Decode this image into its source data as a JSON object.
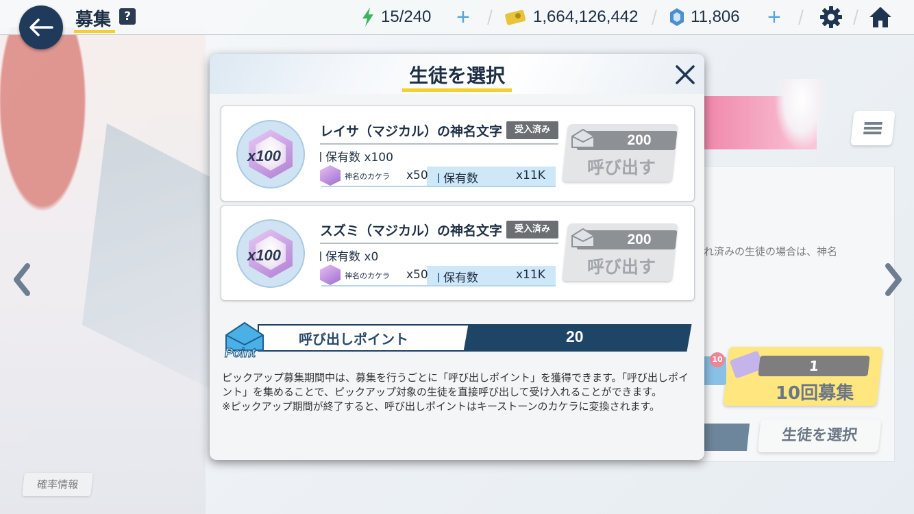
{
  "topbar": {
    "title": "募集",
    "help": "?",
    "ap": "15/240",
    "credits": "1,664,126,442",
    "gems": "11,806"
  },
  "background": {
    "panel_text": "入れ済みの生徒の場合は、神名",
    "gacha": {
      "count": "1",
      "label": "10回募集",
      "badge": "10"
    },
    "select_button": "生徒を選択",
    "probability_button": "確率情報"
  },
  "modal": {
    "title": "生徒を選択",
    "cards": [
      {
        "name": "レイサ（マジカル）の神名文字",
        "badge": "受入済み",
        "portrait_count": "x100",
        "owned": "保有数 x100",
        "material_name": "神名のカケラ",
        "material_qty": "x50",
        "material_owned_label": "保有数",
        "material_owned": "x11K",
        "cost": "200",
        "button": "呼び出す"
      },
      {
        "name": "スズミ（マジカル）の神名文字",
        "badge": "受入済み",
        "portrait_count": "x100",
        "owned": "保有数 x0",
        "material_name": "神名のカケラ",
        "material_qty": "x50",
        "material_owned_label": "保有数",
        "material_owned": "x11K",
        "cost": "200",
        "button": "呼び出す"
      }
    ],
    "points": {
      "label": "呼び出しポイント",
      "value": "20",
      "icon_text": "Point"
    },
    "description": [
      "ピックアップ募集期間中は、募集を行うごとに「呼び出しポイント」を獲得できます。「呼び出しポイント」を集めることで、ピックアップ対象の生徒を直接呼び出して受け入れることができます。",
      "※ピックアップ期間が終了すると、呼び出しポイントはキーストーンのカケラに変換されます。"
    ]
  },
  "colors": {
    "accent_yellow": "#f3d02e",
    "navy": "#1f4566",
    "ap_green": "#3bb55a"
  },
  "icons": [
    "back-arrow-icon",
    "help-icon",
    "ap-bolt-icon",
    "credit-icon",
    "gem-icon",
    "gear-icon",
    "home-icon",
    "close-icon",
    "menu-icon",
    "arrow-left-icon",
    "arrow-right-icon",
    "point-envelope-icon"
  ]
}
